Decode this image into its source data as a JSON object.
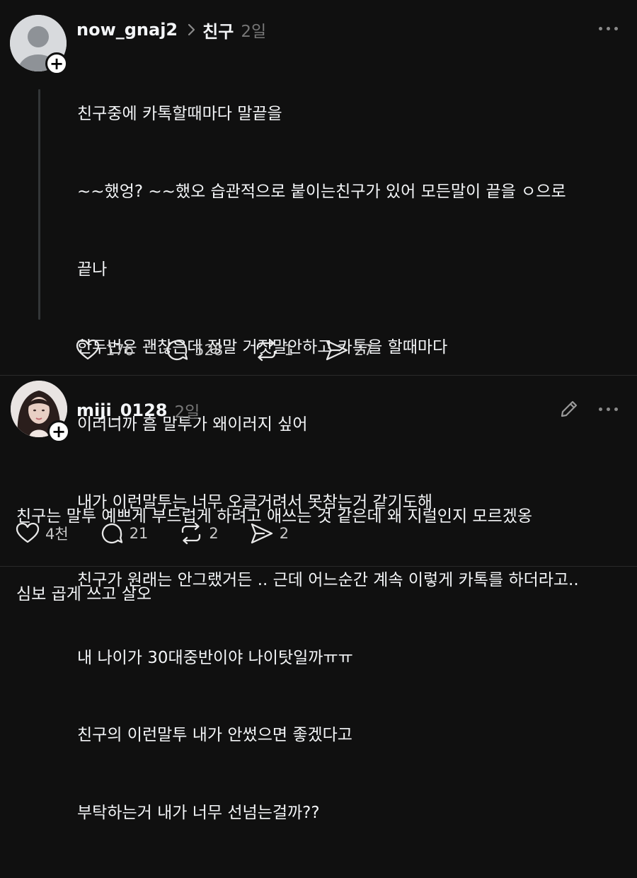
{
  "post1": {
    "username": "now_gnaj2",
    "topic": "친구",
    "time": "2일",
    "lines": [
      "친구중에 카톡할때마다 말끝을",
      "~~했엉? ~~했오 습관적으로 붙이는친구가 있어 모든말이 끝을 ㅇ으로",
      "끝나",
      "한두번은 괜찮은데 정말 거짓말안하고 카톡을 할때마다",
      "이러니까 흠 말투가 왜이러지 싶어",
      "내가 이런말투는 너무 오글거려서 못참는거 같기도해",
      "친구가 원래는 안그랬거든 .. 근데 어느순간 계속 이렇게 카톡를 하더라고..",
      "내 나이가 30대중반이야 나이탓일까ㅠㅠ",
      "친구의 이런말투 내가 안썼으면 좋겠다고",
      "부탁하는거 내가 너무 선넘는걸까??"
    ],
    "likes": "176",
    "comments": "528",
    "reposts": "1",
    "shares": "27"
  },
  "post2": {
    "username": "miji_0128",
    "time": "2일",
    "lines": [
      "친구는 말투 예쁘게 부드럽게 하려고 애쓰는 것 같은데 왜 지럴인지 모르겠옹",
      "심보 곱게 쓰고 살오"
    ],
    "likes": "4천",
    "comments": "21",
    "reposts": "2",
    "shares": "2"
  },
  "icons": {
    "plus": "+",
    "like": "heart-icon",
    "comment": "comment-bubble-icon",
    "repost": "repost-icon",
    "share": "send-icon",
    "more": "more-dots-icon",
    "edit": "pencil-icon"
  },
  "colors": {
    "background": "#101010",
    "text": "#f3f5f7",
    "muted": "#777777"
  }
}
